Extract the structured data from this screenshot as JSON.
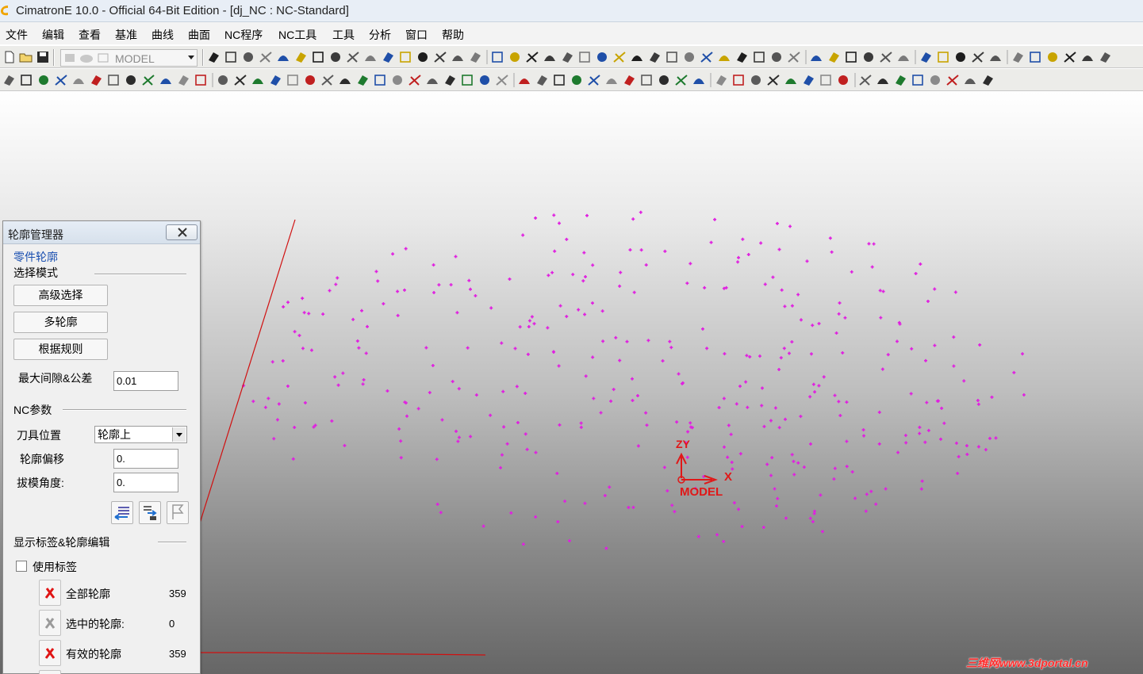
{
  "window": {
    "title": "CimatronE 10.0 - Official 64-Bit Edition - [dj_NC : NC-Standard]"
  },
  "menubar": {
    "items": [
      "文件",
      "编辑",
      "查看",
      "基准",
      "曲线",
      "曲面",
      "NC程序",
      "NC工具",
      "工具",
      "分析",
      "窗口",
      "帮助"
    ]
  },
  "toolbar": {
    "model_combo": "MODEL"
  },
  "viewport": {
    "point_color": "#e020e0",
    "axis_color": "#e01818",
    "axis_label_x": "X",
    "axis_label_zy": "ZY",
    "axis_label_model": "MODEL"
  },
  "panel": {
    "title": "轮廓管理器",
    "part_contour": "零件轮廓",
    "selection_mode": "选择模式",
    "btn_advanced": "高级选择",
    "btn_multi": "多轮廓",
    "btn_rules": "根据规则",
    "max_gap_label": "最大间隙&公差",
    "max_gap_value": "0.01",
    "nc_params": "NC参数",
    "tool_pos_label": "刀具位置",
    "tool_pos_value": "轮廓上",
    "offset_label": "轮廓偏移",
    "offset_value": "0.",
    "draft_label": "拔模角度:",
    "draft_value": "0.",
    "display_section": "显示标签&轮廓编辑",
    "use_tags": "使用标签",
    "all_contours": "全部轮廓",
    "all_count": "359",
    "selected_contours": "选中的轮廓:",
    "selected_count": "0",
    "valid_contours": "有效的轮廓",
    "valid_count": "359"
  },
  "annotation": {
    "arrow_color": "#d01010"
  },
  "watermark": "三维网www.3dportal.cn"
}
